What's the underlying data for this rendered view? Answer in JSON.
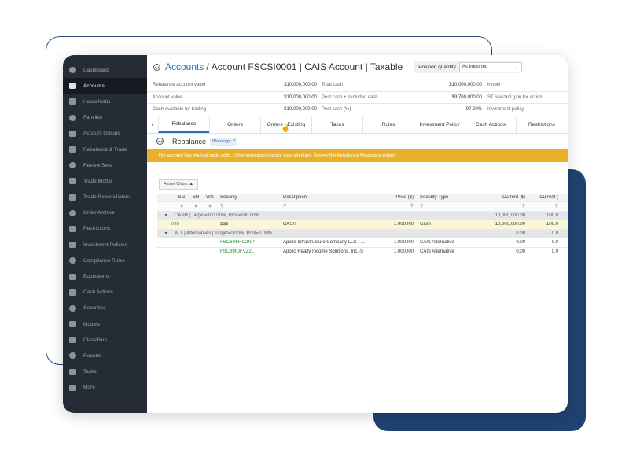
{
  "sidebar": {
    "items": [
      {
        "label": "Dashboard",
        "icon": "dashboard-icon",
        "active": false
      },
      {
        "label": "Accounts",
        "icon": "accounts-icon",
        "active": true
      },
      {
        "label": "Households",
        "icon": "households-icon",
        "active": false
      },
      {
        "label": "Families",
        "icon": "families-icon",
        "active": false
      },
      {
        "label": "Account Groups",
        "icon": "account-groups-icon",
        "active": false
      },
      {
        "label": "Rebalance & Trade",
        "icon": "rebalance-icon",
        "active": false
      },
      {
        "label": "Review Sets",
        "icon": "review-sets-icon",
        "active": false
      },
      {
        "label": "Trade Blotter",
        "icon": "trade-blotter-icon",
        "active": false
      },
      {
        "label": "Trade Reconciliation",
        "icon": "trade-reconciliation-icon",
        "active": false
      },
      {
        "label": "Order Archive",
        "icon": "order-archive-icon",
        "active": false
      },
      {
        "label": "Restrictions",
        "icon": "restrictions-icon",
        "active": false
      },
      {
        "label": "Investment Policies",
        "icon": "investment-policies-icon",
        "active": false
      },
      {
        "label": "Compliance Rules",
        "icon": "compliance-rules-icon",
        "active": false
      },
      {
        "label": "Equivalents",
        "icon": "equivalents-icon",
        "active": false
      },
      {
        "label": "Cash Actions",
        "icon": "cash-actions-icon",
        "active": false
      },
      {
        "label": "Securities",
        "icon": "securities-icon",
        "active": false
      },
      {
        "label": "Models",
        "icon": "models-icon",
        "active": false
      },
      {
        "label": "Classifiers",
        "icon": "classifiers-icon",
        "active": false
      },
      {
        "label": "Reports",
        "icon": "reports-icon",
        "active": false
      },
      {
        "label": "Tasks",
        "icon": "tasks-icon",
        "active": false
      },
      {
        "label": "More",
        "icon": "more-icon",
        "active": false
      }
    ]
  },
  "header": {
    "breadcrumb_link": "Accounts",
    "separator": "/",
    "account_title": "Account FSCSI0001 | CAIS Account | Taxable",
    "position_quantity_label": "Position quantity",
    "position_quantity_value": "As Imported"
  },
  "summary": {
    "rows": [
      {
        "l1": "Rebalance account value",
        "v1": "$10,000,000.00",
        "l2": "Total cash",
        "v2": "$10,000,000.00",
        "l3": "Model"
      },
      {
        "l1": "Account value",
        "v1": "$10,000,000.00",
        "l2": "Post cash + excluded cash",
        "v2": "$9,700,000.00",
        "l3": "ST realized gain for action"
      },
      {
        "l1": "Cash available for trading",
        "v1": "$10,000,000.00",
        "l2": "Post cash (%)",
        "v2": "97.00%",
        "l3": "Investment policy"
      }
    ]
  },
  "tabs": [
    "Rebalance",
    "Orders",
    "Orders - Existing",
    "Taxes",
    "Rules",
    "Investment Policy",
    "Cash Actions",
    "Restrictions"
  ],
  "section": {
    "title": "Rebalance",
    "badge": "Warnings: 2"
  },
  "warning": "The account has manual trade edits. Other messages require your attention. Review the Rebalance Messages widget.",
  "group_chip": "Asset Class ▲",
  "grid": {
    "headers": {
      "sg": "SG",
      "sr": "SR",
      "ws": "WS",
      "security": "Security",
      "description": "Description",
      "price": "Price ($)",
      "type": "Security Type",
      "current": "Current ($)",
      "current2": "Current ("
    },
    "groups": [
      {
        "label": "CASH | Target=100.00%, Post=100.00%",
        "current": "10,000,000.00",
        "current2": "100.0",
        "rows": [
          {
            "action": "Info",
            "security": "$$$",
            "description": "CASH",
            "price": "1.000000",
            "type": "Cash",
            "current": "10,000,000.00",
            "current2": "100.0"
          }
        ]
      },
      {
        "label": "ALT | Alternatives | Target=0.00%, Post=0.00%",
        "current": "0.00",
        "current2": "0.0",
        "rows": [
          {
            "action": "",
            "security": "FSC6U6RO2NP",
            "description": "Apollo Infrastructure Company LLC I-...",
            "price": "1.000000",
            "type": "CAIS Alternative",
            "current": "0.00",
            "current2": "0.0"
          },
          {
            "action": "",
            "security": "FSC3MOFVZ2L",
            "description": "Apollo Realty Income Solutions, Inc.-S",
            "price": "1.000000",
            "type": "CAIS Alternative",
            "current": "0.00",
            "current2": "0.0"
          }
        ]
      }
    ]
  }
}
